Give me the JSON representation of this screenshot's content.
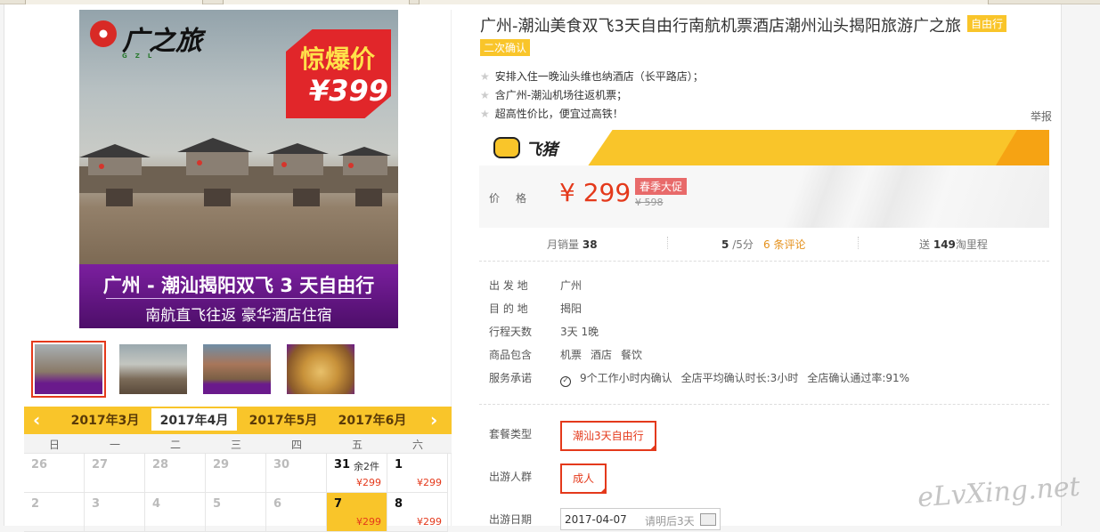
{
  "product": {
    "title": "广州-潮汕美食双飞3天自由行南航机票酒店潮州汕头揭阳旅游广之旅",
    "type_badge": "自由行",
    "confirm_badge": "二次确认",
    "features": [
      "安排入住一晚汕头维也纳酒店（长平路店）；",
      "含广州-潮汕机场往返机票；",
      "超高性价比，便宜过高铁！"
    ],
    "report": "举报"
  },
  "image": {
    "logo_text": "广之旅",
    "logo_sub": "GZL",
    "promo_top": "惊爆价",
    "promo_price": "¥399",
    "banner_line1": "广州 - 潮汕揭阳双飞 3 天自由行",
    "banner_line2": "南航直飞往返 豪华酒店住宿"
  },
  "thumbnails": [
    "thumb-1-promo",
    "thumb-2-bridge",
    "thumb-3-gate",
    "thumb-4-food"
  ],
  "calendar": {
    "prev": "‹",
    "next": "›",
    "months": [
      "2017年3月",
      "2017年4月",
      "2017年5月",
      "2017年6月"
    ],
    "active_month": "2017年4月",
    "weekdays": [
      "日",
      "一",
      "二",
      "三",
      "四",
      "五",
      "六"
    ],
    "rows": [
      [
        {
          "d": "26"
        },
        {
          "d": "27"
        },
        {
          "d": "28"
        },
        {
          "d": "29"
        },
        {
          "d": "30"
        },
        {
          "d": "31",
          "rem": "余2件",
          "p": "¥299",
          "act": true
        },
        {
          "d": "1",
          "p": "¥299",
          "act": true
        }
      ],
      [
        {
          "d": "2"
        },
        {
          "d": "3"
        },
        {
          "d": "4"
        },
        {
          "d": "5"
        },
        {
          "d": "6"
        },
        {
          "d": "7",
          "p": "¥299",
          "act": true,
          "hl": true
        },
        {
          "d": "8",
          "p": "¥299",
          "act": true
        }
      ]
    ]
  },
  "brand": {
    "name": "飞猪"
  },
  "price": {
    "label": "价格",
    "current": "¥ 299",
    "promo": "春季大促",
    "original": "¥ 598"
  },
  "stats": {
    "sales_label": "月销量",
    "sales_value": "38",
    "rating_value": "5",
    "rating_suffix": "/5分",
    "reviews_count": "6",
    "reviews_label": "条评论",
    "mileage_prefix": "送",
    "mileage_value": "149",
    "mileage_suffix": "淘里程"
  },
  "details": [
    {
      "label": "出 发 地",
      "value": "广州"
    },
    {
      "label": "目 的 地",
      "value": "揭阳"
    },
    {
      "label": "行程天数",
      "value": "3天 1晚"
    },
    {
      "label": "商品包含",
      "values": [
        "机票",
        "酒店",
        "餐饮"
      ]
    },
    {
      "label": "服务承诺",
      "values": [
        "9个工作小时内确认",
        "全店平均确认时长:3小时",
        "全店确认通过率:91%"
      ]
    }
  ],
  "options": {
    "package_label": "套餐类型",
    "package_value": "潮汕3天自由行",
    "group_label": "出游人群",
    "group_value": "成人",
    "date_label": "出游日期",
    "date_value": "2017-04-07",
    "date_hint": "请明后3天"
  },
  "watermark": "eLvXing.net",
  "colors": {
    "accent": "#f9c52a",
    "price": "#e4391b",
    "banner": "#6a1a8c"
  }
}
